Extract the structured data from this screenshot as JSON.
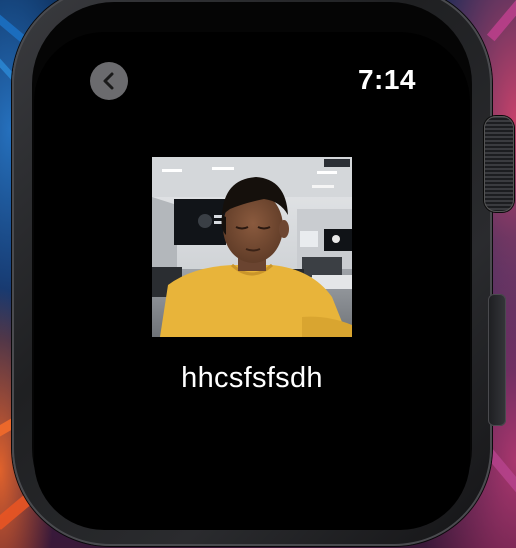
{
  "status_bar": {
    "time": "7:14"
  },
  "navigation": {
    "back_icon": "chevron-left-icon"
  },
  "content": {
    "photo_description_icon": "photo",
    "caption": "hhcsfsfsdh"
  },
  "colors": {
    "screen_background": "#000000",
    "back_button_background": "#6b6b6e",
    "text": "#ffffff",
    "shirt": "#e8b43a"
  }
}
